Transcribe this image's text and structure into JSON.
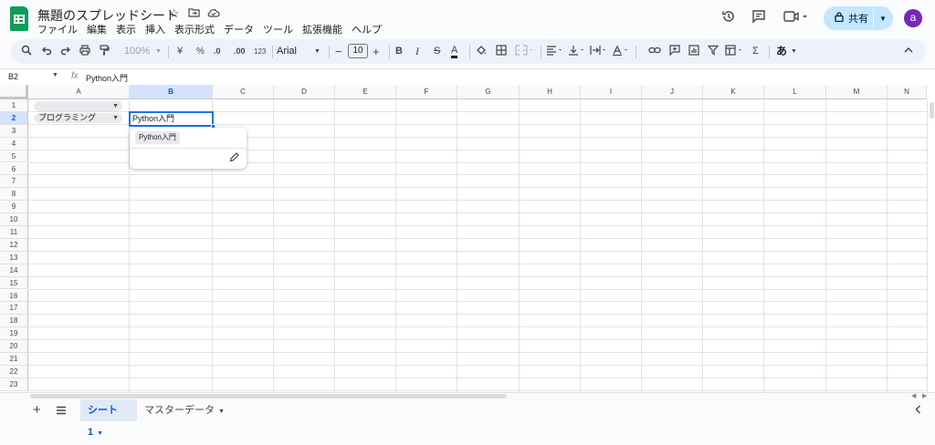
{
  "app": {
    "title": "無題のスプレッドシート",
    "menu": [
      "ファイル",
      "編集",
      "表示",
      "挿入",
      "表示形式",
      "データ",
      "ツール",
      "拡張機能",
      "ヘルプ"
    ],
    "share_label": "共有",
    "avatar_letter": "a",
    "accent": "#0f9d58",
    "avatar_color": "#7627bb"
  },
  "toolbar": {
    "zoom": "100%",
    "currency": "¥",
    "percent": "%",
    "dec_decrease": ".0",
    "dec_increase": ".00",
    "number_format": "123",
    "font": "Arial",
    "font_size": "10",
    "bold": "B",
    "italic": "I",
    "strike": "S",
    "text_color": "A",
    "sum": "Σ",
    "input_tools": "あ"
  },
  "formula_bar": {
    "cell_ref": "B2",
    "fx": "fx",
    "value": "Python入門"
  },
  "grid": {
    "columns": [
      "A",
      "B",
      "C",
      "D",
      "E",
      "F",
      "G",
      "H",
      "I",
      "J",
      "K",
      "L",
      "M",
      "N"
    ],
    "rows": [
      "1",
      "2",
      "3",
      "4",
      "5",
      "6",
      "7",
      "8",
      "9",
      "10",
      "11",
      "12",
      "13",
      "14",
      "15",
      "16",
      "17",
      "18",
      "19",
      "20",
      "21",
      "22",
      "23"
    ],
    "selected_column": "B",
    "selected_row": "2",
    "a1_chip": "",
    "a2_chip": "プログラミング",
    "b2_value": "Python入門",
    "dropdown_option": "Python入門"
  },
  "sheets": {
    "tabs": [
      "シート1",
      "マスターデータ"
    ],
    "active": "シート1"
  }
}
